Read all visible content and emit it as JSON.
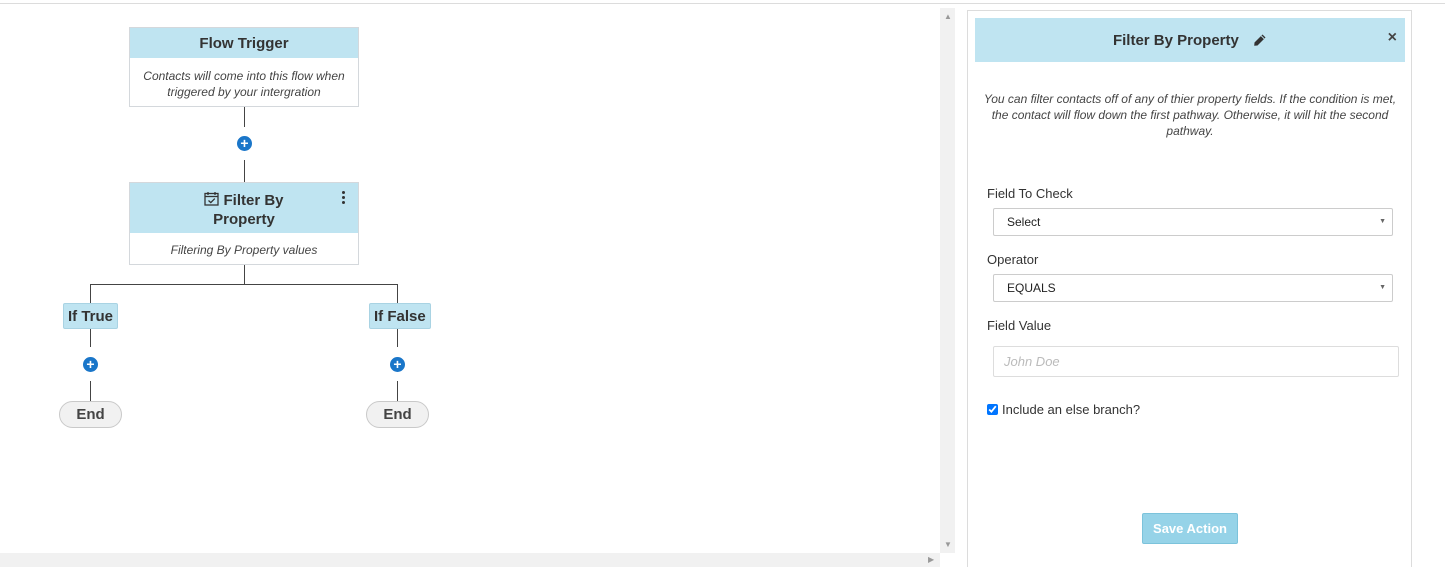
{
  "canvas": {
    "trigger": {
      "title": "Flow Trigger",
      "description": "Contacts will come into this flow when triggered by your intergration"
    },
    "filter_node": {
      "title_line1": "Filter By",
      "title_line2": "Property",
      "description": "Filtering By Property values",
      "icon": "calendar-check-icon"
    },
    "branches": {
      "true_label": "If True",
      "false_label": "If False",
      "end_label": "End"
    },
    "add_icon": "plus-circle-icon"
  },
  "panel": {
    "title": "Filter By Property",
    "close": "×",
    "description": "You can filter contacts off of any of thier property fields. If the condition is met, the contact will flow down the first pathway. Otherwise, it will hit the second pathway.",
    "field_to_check_label": "Field To Check",
    "field_to_check_value": "Select",
    "operator_label": "Operator",
    "operator_value": "EQUALS",
    "field_value_label": "Field Value",
    "field_value_placeholder": "John Doe",
    "else_branch_label": "Include an else branch?",
    "else_branch_checked": true,
    "save_label": "Save Action"
  },
  "colors": {
    "node_header": "#bfe4f1",
    "plus_button": "#1a76c9",
    "save_button": "#96d3e8"
  }
}
